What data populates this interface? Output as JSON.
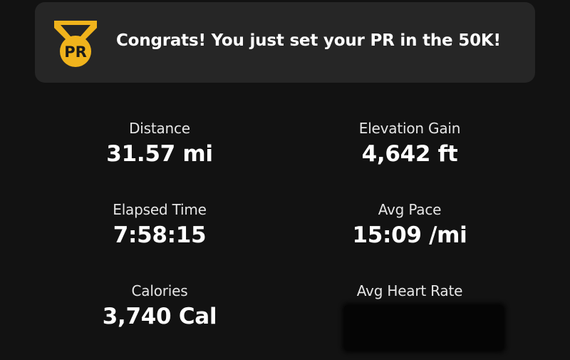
{
  "banner": {
    "badge_text": "PR",
    "message": "Congrats! You just set your PR in the 50K!",
    "badge_color": "#f0b31c"
  },
  "stats": [
    {
      "label": "Distance",
      "value": "31.57 mi"
    },
    {
      "label": "Elevation Gain",
      "value": "4,642 ft"
    },
    {
      "label": "Elapsed Time",
      "value": "7:58:15"
    },
    {
      "label": "Avg Pace",
      "value": "15:09 /mi"
    },
    {
      "label": "Calories",
      "value": "3,740 Cal"
    },
    {
      "label": "Avg Heart Rate"
    }
  ]
}
